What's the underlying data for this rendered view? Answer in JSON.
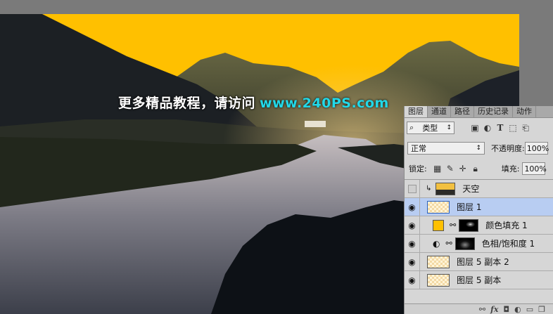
{
  "watermark": {
    "text_cn": "更多精品教程，请访问",
    "text_url": "www.240PS.com"
  },
  "panel": {
    "tabs": [
      "图层",
      "通道",
      "路径",
      "历史记录",
      "动作"
    ],
    "filter": {
      "label": "类型",
      "icons": [
        "image-filter-icon",
        "adjustment-filter-icon",
        "type-filter-icon",
        "shape-filter-icon",
        "smart-object-filter-icon"
      ]
    },
    "blend_mode": "正常",
    "opacity_label": "不透明度:",
    "opacity_value": "100%",
    "lock_label": "锁定:",
    "fill_label": "填充:",
    "fill_value": "100%",
    "layers": [
      {
        "name": "天空",
        "visible": false,
        "clipped": true
      },
      {
        "name": "图层 1",
        "visible": true,
        "selected": true
      },
      {
        "name": "颜色填充 1",
        "visible": true,
        "fill_color": "#ffc000"
      },
      {
        "name": "色相/饱和度 1",
        "visible": true
      },
      {
        "name": "图层 5 副本 2",
        "visible": true
      },
      {
        "name": "图层 5 副本",
        "visible": true
      }
    ],
    "bottom_icons": [
      "link-icon",
      "fx-icon",
      "mask-icon",
      "adjustment-icon",
      "folder-icon",
      "new-layer-icon"
    ]
  },
  "colors": {
    "sky": "#ffc000",
    "selected_layer": "#b8cdf2",
    "watermark_url": "#22d8e8"
  }
}
